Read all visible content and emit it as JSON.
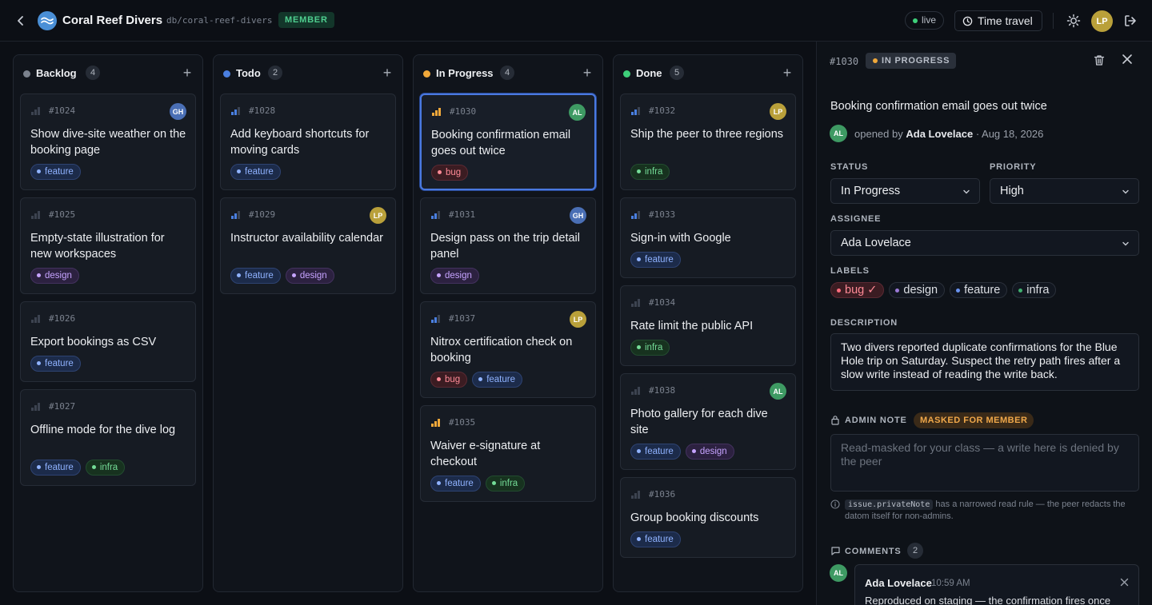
{
  "header": {
    "title": "Coral Reef Divers",
    "path": "db/coral-reef-divers",
    "role": "MEMBER",
    "live": "live",
    "time_travel": "Time travel",
    "user_initials": "LP"
  },
  "colors": {
    "backlog": "#7b828e",
    "todo": "#4a7fe0",
    "in_progress": "#f0a83a",
    "done": "#3ecf7a",
    "avatar_gh": "#4a6fb5",
    "avatar_al": "#3e9a63",
    "avatar_lp": "#b9a03a"
  },
  "columns": [
    {
      "title": "Backlog",
      "count": "4",
      "cards": [
        {
          "id": "#1024",
          "title": "Show dive-site weather on the booking page",
          "avatar": "GH",
          "tags": [
            "feature"
          ]
        },
        {
          "id": "#1025",
          "title": "Empty-state illustration for new workspaces",
          "avatar": "",
          "tags": [
            "design"
          ]
        },
        {
          "id": "#1026",
          "title": "Export bookings as CSV",
          "avatar": "",
          "tags": [
            "feature"
          ]
        },
        {
          "id": "#1027",
          "title": "Offline mode for the dive log",
          "avatar": "",
          "tags": [
            "feature",
            "infra"
          ]
        }
      ]
    },
    {
      "title": "Todo",
      "count": "2",
      "cards": [
        {
          "id": "#1028",
          "title": "Add keyboard shortcuts for moving cards",
          "avatar": "",
          "tags": [
            "feature"
          ]
        },
        {
          "id": "#1029",
          "title": "Instructor availability calendar",
          "avatar": "LP",
          "tags": [
            "feature",
            "design"
          ]
        }
      ]
    },
    {
      "title": "In Progress",
      "count": "4",
      "cards": [
        {
          "id": "#1030",
          "title": "Booking confirmation email goes out twice",
          "avatar": "AL",
          "tags": [
            "bug"
          ]
        },
        {
          "id": "#1031",
          "title": "Design pass on the trip detail panel",
          "avatar": "GH",
          "tags": [
            "design"
          ]
        },
        {
          "id": "#1037",
          "title": "Nitrox certification check on booking",
          "avatar": "LP",
          "tags": [
            "bug",
            "feature"
          ]
        },
        {
          "id": "#1035",
          "title": "Waiver e-signature at checkout",
          "avatar": "",
          "tags": [
            "feature",
            "infra"
          ]
        }
      ]
    },
    {
      "title": "Done",
      "count": "5",
      "cards": [
        {
          "id": "#1032",
          "title": "Ship the peer to three regions",
          "avatar": "LP",
          "tags": [
            "infra"
          ]
        },
        {
          "id": "#1033",
          "title": "Sign-in with Google",
          "avatar": "",
          "tags": [
            "feature"
          ]
        },
        {
          "id": "#1034",
          "title": "Rate limit the public API",
          "avatar": "",
          "tags": [
            "infra"
          ]
        },
        {
          "id": "#1038",
          "title": "Photo gallery for each dive site",
          "avatar": "AL",
          "tags": [
            "feature",
            "design"
          ]
        },
        {
          "id": "#1036",
          "title": "Group booking discounts",
          "avatar": "",
          "tags": [
            "feature"
          ]
        }
      ]
    }
  ],
  "detail": {
    "id": "#1030",
    "status_badge": "IN PROGRESS",
    "title": "Booking confirmation email goes out twice",
    "author_initials": "AL",
    "opened_prefix": "opened by",
    "author": "Ada Lovelace",
    "date": "· Aug 18, 2026",
    "status_label": "STATUS",
    "status_value": "In Progress",
    "priority_label": "PRIORITY",
    "priority_value": "High",
    "assignee_label": "ASSIGNEE",
    "assignee_value": "Ada Lovelace",
    "labels_label": "LABELS",
    "labels": [
      "bug ✓",
      "design",
      "feature",
      "infra"
    ],
    "description_label": "DESCRIPTION",
    "description": "Two divers reported duplicate confirmations for the Blue Hole trip on Saturday. Suspect the retry path fires after a slow write instead of reading the write back.",
    "admin_note_label": "ADMIN NOTE",
    "masked_badge": "MASKED FOR MEMBER",
    "admin_note_placeholder": "Read-masked for your class — a write here is denied by the peer",
    "info_code": "issue.privateNote",
    "info_text": " has a narrowed read rule — the peer redacts the datom itself for non-admins.",
    "comments_label": "COMMENTS",
    "comments_count": "2",
    "comment": {
      "initials": "AL",
      "author": "Ada Lovelace",
      "time": "10:59 AM",
      "body": "Reproduced on staging — the confirmation fires once"
    }
  }
}
